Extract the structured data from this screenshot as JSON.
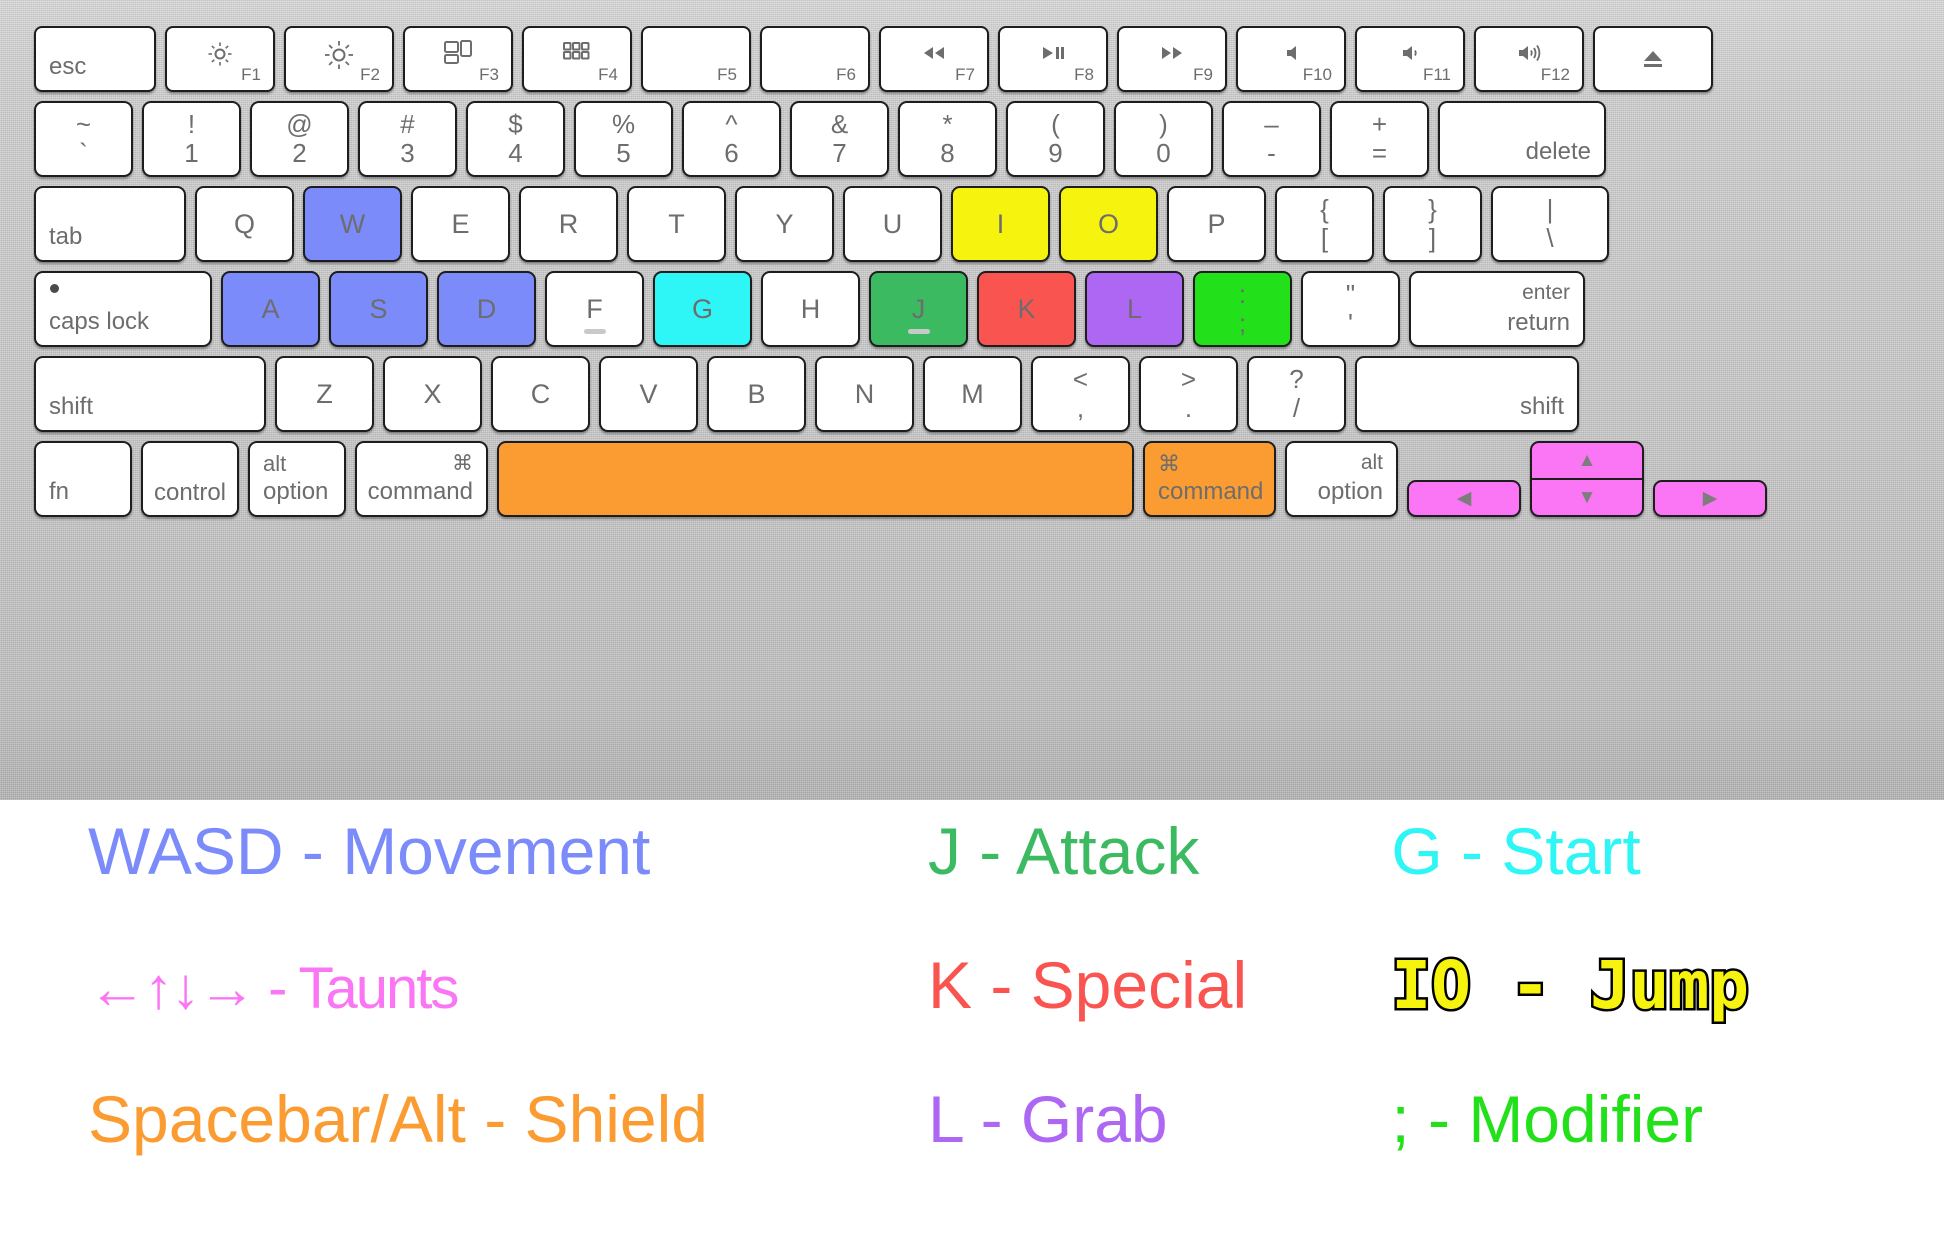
{
  "keyboard": {
    "rows": [
      {
        "name": "function-row",
        "keys": [
          {
            "name": "esc",
            "label": "esc",
            "layout": "bl",
            "width": "w-esc",
            "color": "white"
          },
          {
            "name": "f1",
            "glyph": "brightness-down-icon",
            "fn": "F1",
            "layout": "glyph-fn",
            "width": "w-fn",
            "color": "white"
          },
          {
            "name": "f2",
            "glyph": "brightness-up-icon",
            "fn": "F2",
            "layout": "glyph-fn",
            "width": "w-fn",
            "color": "white"
          },
          {
            "name": "f3",
            "glyph": "mission-control-icon",
            "fn": "F3",
            "layout": "glyph-fn",
            "width": "w-fn",
            "color": "white"
          },
          {
            "name": "f4",
            "glyph": "launchpad-icon",
            "fn": "F4",
            "layout": "glyph-fn",
            "width": "w-fn",
            "color": "white"
          },
          {
            "name": "f5",
            "glyph": "",
            "fn": "F5",
            "layout": "glyph-fn",
            "width": "w-fn",
            "color": "white"
          },
          {
            "name": "f6",
            "glyph": "",
            "fn": "F6",
            "layout": "glyph-fn",
            "width": "w-fn",
            "color": "white"
          },
          {
            "name": "f7",
            "glyph": "rewind-icon",
            "fn": "F7",
            "layout": "glyph-fn",
            "width": "w-fn",
            "color": "white"
          },
          {
            "name": "f8",
            "glyph": "play-pause-icon",
            "fn": "F8",
            "layout": "glyph-fn",
            "width": "w-fn",
            "color": "white"
          },
          {
            "name": "f9",
            "glyph": "fast-forward-icon",
            "fn": "F9",
            "layout": "glyph-fn",
            "width": "w-fn",
            "color": "white"
          },
          {
            "name": "f10",
            "glyph": "mute-icon",
            "fn": "F10",
            "layout": "glyph-fn",
            "width": "w-fn",
            "color": "white"
          },
          {
            "name": "f11",
            "glyph": "volume-down-icon",
            "fn": "F11",
            "layout": "glyph-fn",
            "width": "w-fn",
            "color": "white"
          },
          {
            "name": "f12",
            "glyph": "volume-up-icon",
            "fn": "F12",
            "layout": "glyph-fn",
            "width": "w-fn",
            "color": "white"
          },
          {
            "name": "eject",
            "glyph": "eject-icon",
            "layout": "glyph-only",
            "width": "w-eject",
            "color": "white"
          }
        ]
      },
      {
        "name": "number-row",
        "keys": [
          {
            "name": "backtick",
            "upper": "~",
            "lower": "`",
            "layout": "stack",
            "width": "w-1",
            "color": "white"
          },
          {
            "name": "digit-1",
            "upper": "!",
            "lower": "1",
            "layout": "stack",
            "width": "w-1",
            "color": "white"
          },
          {
            "name": "digit-2",
            "upper": "@",
            "lower": "2",
            "layout": "stack",
            "width": "w-1",
            "color": "white"
          },
          {
            "name": "digit-3",
            "upper": "#",
            "lower": "3",
            "layout": "stack",
            "width": "w-1",
            "color": "white"
          },
          {
            "name": "digit-4",
            "upper": "$",
            "lower": "4",
            "layout": "stack",
            "width": "w-1",
            "color": "white"
          },
          {
            "name": "digit-5",
            "upper": "%",
            "lower": "5",
            "layout": "stack",
            "width": "w-1",
            "color": "white"
          },
          {
            "name": "digit-6",
            "upper": "^",
            "lower": "6",
            "layout": "stack",
            "width": "w-1",
            "color": "white"
          },
          {
            "name": "digit-7",
            "upper": "&",
            "lower": "7",
            "layout": "stack",
            "width": "w-1",
            "color": "white"
          },
          {
            "name": "digit-8",
            "upper": "*",
            "lower": "8",
            "layout": "stack",
            "width": "w-1",
            "color": "white"
          },
          {
            "name": "digit-9",
            "upper": "(",
            "lower": "9",
            "layout": "stack",
            "width": "w-1",
            "color": "white"
          },
          {
            "name": "digit-0",
            "upper": ")",
            "lower": "0",
            "layout": "stack",
            "width": "w-1",
            "color": "white"
          },
          {
            "name": "minus",
            "upper": "–",
            "lower": "-",
            "layout": "stack",
            "width": "w-1",
            "color": "white"
          },
          {
            "name": "equals",
            "upper": "+",
            "lower": "=",
            "layout": "stack",
            "width": "w-1",
            "color": "white"
          },
          {
            "name": "delete",
            "label": "delete",
            "layout": "br",
            "width": "w-del",
            "color": "white"
          }
        ]
      },
      {
        "name": "qwerty-row",
        "keys": [
          {
            "name": "tab",
            "label": "tab",
            "layout": "bl",
            "width": "w-tab",
            "color": "white"
          },
          {
            "name": "key-q",
            "label": "Q",
            "layout": "center",
            "width": "w-1",
            "color": "white"
          },
          {
            "name": "key-w",
            "label": "W",
            "layout": "center",
            "width": "w-1",
            "color": "blue"
          },
          {
            "name": "key-e",
            "label": "E",
            "layout": "center",
            "width": "w-1",
            "color": "white"
          },
          {
            "name": "key-r",
            "label": "R",
            "layout": "center",
            "width": "w-1",
            "color": "white"
          },
          {
            "name": "key-t",
            "label": "T",
            "layout": "center",
            "width": "w-1",
            "color": "white"
          },
          {
            "name": "key-y",
            "label": "Y",
            "layout": "center",
            "width": "w-1",
            "color": "white"
          },
          {
            "name": "key-u",
            "label": "U",
            "layout": "center",
            "width": "w-1",
            "color": "white"
          },
          {
            "name": "key-i",
            "label": "I",
            "layout": "center",
            "width": "w-1",
            "color": "yellow"
          },
          {
            "name": "key-o",
            "label": "O",
            "layout": "center",
            "width": "w-1",
            "color": "yellow"
          },
          {
            "name": "key-p",
            "label": "P",
            "layout": "center",
            "width": "w-1",
            "color": "white"
          },
          {
            "name": "bracket-left",
            "upper": "{",
            "lower": "[",
            "layout": "stack",
            "width": "w-1",
            "color": "white"
          },
          {
            "name": "bracket-right",
            "upper": "}",
            "lower": "]",
            "layout": "stack",
            "width": "w-1",
            "color": "white"
          },
          {
            "name": "backslash",
            "upper": "|",
            "lower": "\\",
            "layout": "stack",
            "width": "w-bsl",
            "color": "white"
          }
        ]
      },
      {
        "name": "home-row",
        "keys": [
          {
            "name": "caps-lock",
            "label": "caps lock",
            "layout": "bl-dot",
            "width": "w-caps",
            "color": "white"
          },
          {
            "name": "key-a",
            "label": "A",
            "layout": "center",
            "width": "w-1",
            "color": "blue"
          },
          {
            "name": "key-s",
            "label": "S",
            "layout": "center",
            "width": "w-1",
            "color": "blue"
          },
          {
            "name": "key-d",
            "label": "D",
            "layout": "center",
            "width": "w-1",
            "color": "blue"
          },
          {
            "name": "key-f",
            "label": "F",
            "layout": "center-home",
            "width": "w-1",
            "color": "white"
          },
          {
            "name": "key-g",
            "label": "G",
            "layout": "center",
            "width": "w-1",
            "color": "cyan"
          },
          {
            "name": "key-h",
            "label": "H",
            "layout": "center",
            "width": "w-1",
            "color": "white"
          },
          {
            "name": "key-j",
            "label": "J",
            "layout": "center-home",
            "width": "w-1",
            "color": "green"
          },
          {
            "name": "key-k",
            "label": "K",
            "layout": "center",
            "width": "w-1",
            "color": "red"
          },
          {
            "name": "key-l",
            "label": "L",
            "layout": "center",
            "width": "w-1",
            "color": "purple"
          },
          {
            "name": "semicolon",
            "upper": ":",
            "lower": ";",
            "layout": "stack",
            "width": "w-1",
            "color": "lime"
          },
          {
            "name": "quote",
            "upper": "\"",
            "lower": "'",
            "layout": "stack",
            "width": "w-1",
            "color": "white"
          },
          {
            "name": "return",
            "upper": "enter",
            "lower": "return",
            "layout": "enter",
            "width": "w-ret",
            "color": "white"
          }
        ]
      },
      {
        "name": "shift-row",
        "keys": [
          {
            "name": "shift-left",
            "label": "shift",
            "layout": "bl",
            "width": "w-lsh",
            "color": "white"
          },
          {
            "name": "key-z",
            "label": "Z",
            "layout": "center",
            "width": "w-1",
            "color": "white"
          },
          {
            "name": "key-x",
            "label": "X",
            "layout": "center",
            "width": "w-1",
            "color": "white"
          },
          {
            "name": "key-c",
            "label": "C",
            "layout": "center",
            "width": "w-1",
            "color": "white"
          },
          {
            "name": "key-v",
            "label": "V",
            "layout": "center",
            "width": "w-1",
            "color": "white"
          },
          {
            "name": "key-b",
            "label": "B",
            "layout": "center",
            "width": "w-1",
            "color": "white"
          },
          {
            "name": "key-n",
            "label": "N",
            "layout": "center",
            "width": "w-1",
            "color": "white"
          },
          {
            "name": "key-m",
            "label": "M",
            "layout": "center",
            "width": "w-1",
            "color": "white"
          },
          {
            "name": "comma",
            "upper": "<",
            "lower": ",",
            "layout": "stack",
            "width": "w-1",
            "color": "white"
          },
          {
            "name": "period",
            "upper": ">",
            "lower": ".",
            "layout": "stack",
            "width": "w-1",
            "color": "white"
          },
          {
            "name": "slash",
            "upper": "?",
            "lower": "/",
            "layout": "stack",
            "width": "w-1",
            "color": "white"
          },
          {
            "name": "shift-right",
            "label": "shift",
            "layout": "br",
            "width": "w-rsh",
            "color": "white"
          }
        ]
      },
      {
        "name": "bottom-row",
        "keys": [
          {
            "name": "fn",
            "label": "fn",
            "layout": "bl",
            "width": "w-mod",
            "color": "white"
          },
          {
            "name": "control",
            "label": "control",
            "layout": "cb",
            "width": "w-mod",
            "color": "white"
          },
          {
            "name": "option-left",
            "upper": "alt",
            "lower": "option",
            "layout": "two-left",
            "width": "w-mod",
            "color": "white"
          },
          {
            "name": "command-left",
            "upper": "⌘",
            "lower": "command",
            "layout": "two-right",
            "width": "w-cmd",
            "color": "white"
          },
          {
            "name": "spacebar",
            "label": "",
            "layout": "center",
            "width": "w-space",
            "color": "orange"
          },
          {
            "name": "command-right",
            "upper": "⌘",
            "lower": "command",
            "layout": "two-left",
            "width": "w-cmd",
            "color": "orange"
          },
          {
            "name": "option-right",
            "upper": "alt",
            "lower": "option",
            "layout": "two-right",
            "width": "w-opt",
            "color": "white"
          }
        ]
      }
    ],
    "arrow_keys": [
      {
        "name": "arrow-left",
        "glyph": "◀",
        "color": "pink"
      },
      {
        "name": "arrow-up",
        "glyph": "▲",
        "color": "pink"
      },
      {
        "name": "arrow-down",
        "glyph": "▼",
        "color": "pink"
      },
      {
        "name": "arrow-right",
        "glyph": "▶",
        "color": "pink"
      }
    ],
    "colors": {
      "blue": "#7b8bfa",
      "yellow": "#f6f40e",
      "cyan": "#2ef6f6",
      "green": "#3cba62",
      "red": "#fa5450",
      "purple": "#ad67f3",
      "lime": "#22e019",
      "orange": "#fb9c32",
      "pink": "#fb76f4",
      "white": "#ffffff"
    }
  },
  "legend": {
    "rows": [
      {
        "col1": {
          "text": "WASD - Movement",
          "color": "#7b8bfa"
        },
        "col2": {
          "text": "J - Attack",
          "color": "#3cba62"
        },
        "col3": {
          "text": "G - Start",
          "color": "#2ef6f6"
        }
      },
      {
        "col1": {
          "text": "←↑↓→ - Taunts",
          "color": "#fb76f4"
        },
        "col2": {
          "text": "K - Special",
          "color": "#fa5450"
        },
        "col3": {
          "text": "IO - Jump",
          "color": "#f6f40e"
        }
      },
      {
        "col1": {
          "text": "Spacebar/Alt - Shield",
          "color": "#fb9c32"
        },
        "col2": {
          "text": "L - Grab",
          "color": "#ad67f3"
        },
        "col3": {
          "text": "; - Modifier",
          "color": "#22e019"
        }
      }
    ]
  }
}
